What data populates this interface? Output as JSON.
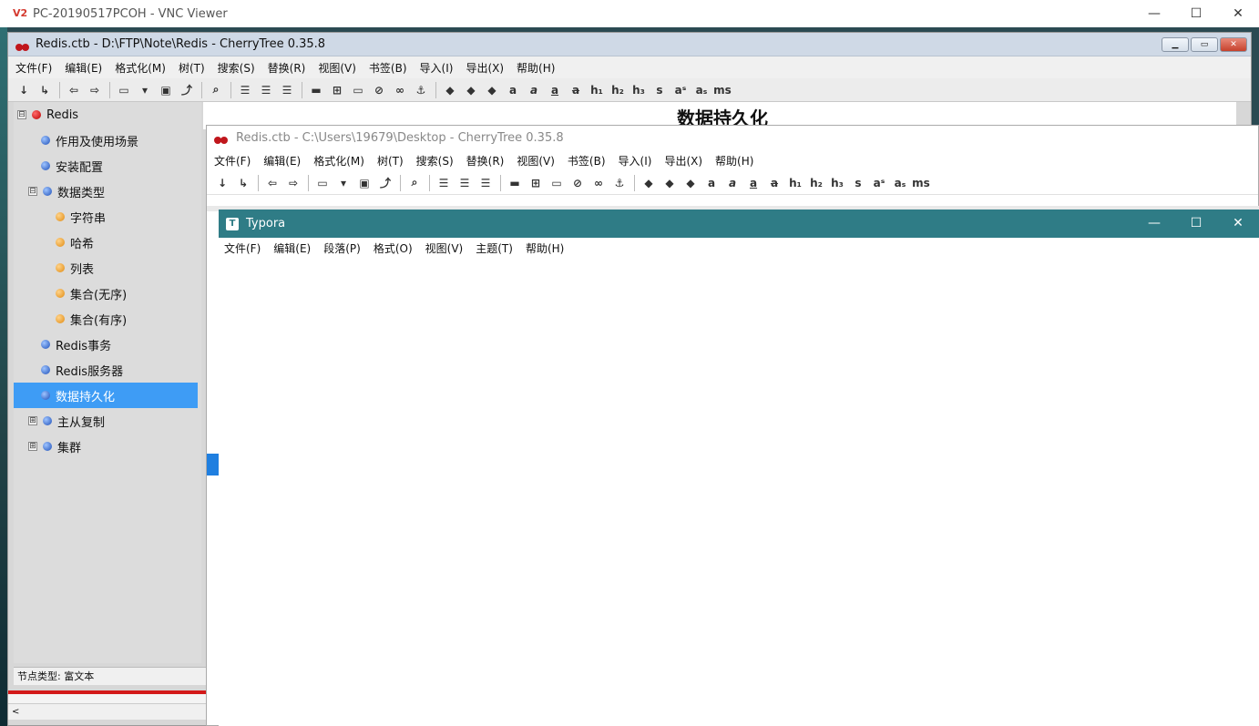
{
  "vnc": {
    "logo": "V2",
    "title": "PC-20190517PCOH - VNC Viewer",
    "controls": {
      "minimize": "—",
      "maximize": "☐",
      "close": "✕"
    }
  },
  "ct_back": {
    "title": "Redis.ctb - D:\\FTP\\Note\\Redis - CherryTree 0.35.8",
    "menu": [
      "文件(F)",
      "编辑(E)",
      "格式化(M)",
      "树(T)",
      "搜索(S)",
      "替换(R)",
      "视图(V)",
      "书签(B)",
      "导入(I)",
      "导出(X)",
      "帮助(H)"
    ],
    "heading": "数据持久化",
    "status": "节点类型: 富文本",
    "tree": [
      {
        "label": "Redis",
        "icon": "red",
        "expander": "⊟"
      },
      {
        "label": "作用及使用场景",
        "icon": "blue"
      },
      {
        "label": "安装配置",
        "icon": "blue"
      },
      {
        "label": "数据类型",
        "icon": "blue",
        "expander": "⊟"
      },
      {
        "label": "字符串",
        "icon": "orange"
      },
      {
        "label": "哈希",
        "icon": "orange"
      },
      {
        "label": "列表",
        "icon": "orange"
      },
      {
        "label": "集合(无序)",
        "icon": "orange"
      },
      {
        "label": "集合(有序)",
        "icon": "orange"
      },
      {
        "label": "Redis事务",
        "icon": "blue"
      },
      {
        "label": "Redis服务器",
        "icon": "blue"
      },
      {
        "label": "数据持久化",
        "icon": "blue",
        "selected": true
      },
      {
        "label": "主从复制",
        "icon": "blue",
        "expander": "⊞"
      },
      {
        "label": "集群",
        "icon": "blue",
        "expander": "⊞"
      }
    ],
    "scroll_arrow": "<"
  },
  "toolbar": {
    "text_tools": [
      "a",
      "a",
      "a",
      "a",
      "h₁",
      "h₂",
      "h₃",
      "s",
      "aˢ",
      "aₛ",
      "ms"
    ]
  },
  "ct_mid": {
    "title": "Redis.ctb - C:\\Users\\19679\\Desktop - CherryTree 0.35.8",
    "menu": [
      "文件(F)",
      "编辑(E)",
      "格式化(M)",
      "树(T)",
      "搜索(S)",
      "替换(R)",
      "视图(V)",
      "书签(B)",
      "导入(I)",
      "导出(X)",
      "帮助(H)"
    ]
  },
  "typora": {
    "icon": "T",
    "title": "Typora",
    "menu": [
      "文件(F)",
      "编辑(E)",
      "段落(P)",
      "格式(O)",
      "视图(V)",
      "主题(T)",
      "帮助(H)"
    ],
    "controls": {
      "minimize": "—",
      "maximize": "☐",
      "close": "✕"
    }
  }
}
